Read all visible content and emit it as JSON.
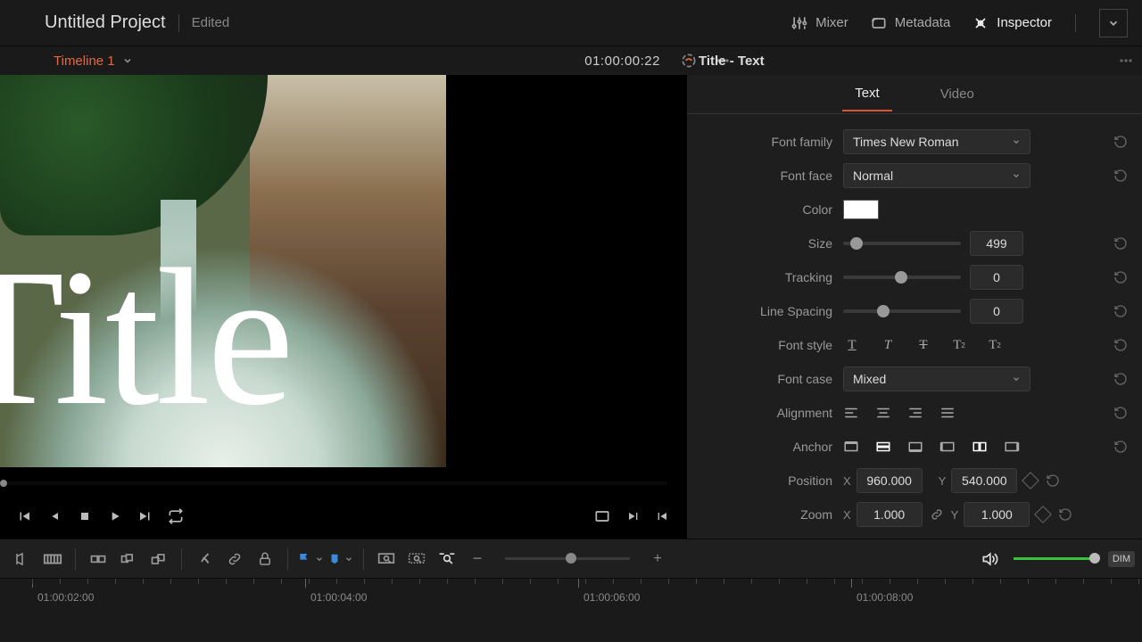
{
  "header": {
    "projectTitle": "Untitled Project",
    "status": "Edited",
    "buttons": {
      "mixer": "Mixer",
      "metadata": "Metadata",
      "inspector": "Inspector"
    }
  },
  "viewerBar": {
    "timelineName": "Timeline 1",
    "timecode": "01:00:00:22"
  },
  "viewer": {
    "overlayText": "Title"
  },
  "inspector": {
    "title": "Title - Text",
    "tabs": {
      "text": "Text",
      "video": "Video"
    },
    "labels": {
      "fontFamily": "Font family",
      "fontFace": "Font face",
      "color": "Color",
      "size": "Size",
      "tracking": "Tracking",
      "lineSpacing": "Line Spacing",
      "fontStyle": "Font style",
      "fontCase": "Font case",
      "alignment": "Alignment",
      "anchor": "Anchor",
      "position": "Position",
      "zoom": "Zoom",
      "x": "X",
      "y": "Y"
    },
    "values": {
      "fontFamily": "Times New Roman",
      "fontFace": "Normal",
      "colorHex": "#FFFFFF",
      "size": "499",
      "tracking": "0",
      "lineSpacing": "0",
      "fontCase": "Mixed",
      "posX": "960.000",
      "posY": "540.000",
      "zoomX": "1.000",
      "zoomY": "1.000"
    }
  },
  "toolbar": {
    "dim": "DIM"
  },
  "ruler": {
    "labels": [
      "01:00:02:00",
      "01:00:04:00",
      "01:00:06:00",
      "01:00:08:00"
    ]
  }
}
